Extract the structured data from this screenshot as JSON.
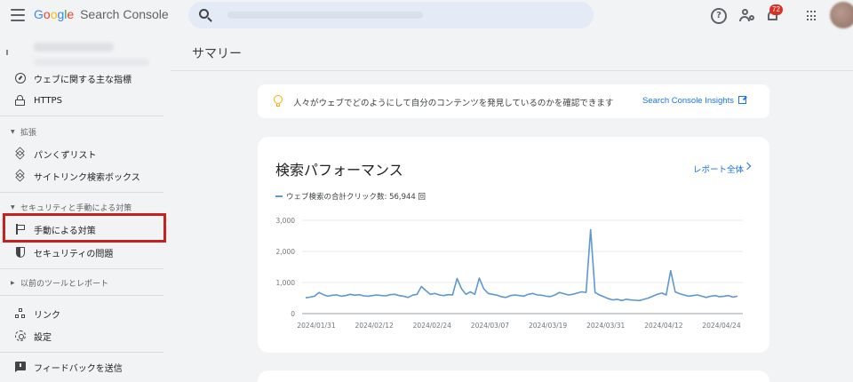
{
  "app": {
    "logo_letters": [
      "G",
      "o",
      "o",
      "g",
      "l",
      "e"
    ],
    "product_name": "Search Console"
  },
  "search": {
    "placeholder": "",
    "value": ""
  },
  "header": {
    "notifications_badge": "72",
    "help_icon": "help-circle-icon",
    "admin_icon": "manage-accounts-icon",
    "apps_icon": "apps-grid-icon"
  },
  "sidebar": {
    "items": [
      {
        "label": "ウェブに関する主な指標",
        "icon": "gauge-icon"
      },
      {
        "label": "HTTPS",
        "icon": "lock-icon"
      },
      {
        "label": "パンくずリスト",
        "icon": "layers-icon"
      },
      {
        "label": "サイトリンク検索ボックス",
        "icon": "layers-icon"
      },
      {
        "label": "手動による対策",
        "icon": "flag-icon"
      },
      {
        "label": "セキュリティの問題",
        "icon": "shield-icon"
      },
      {
        "label": "リンク",
        "icon": "link-icon"
      },
      {
        "label": "設定",
        "icon": "gear-icon"
      },
      {
        "label": "フィードバックを送信",
        "icon": "feedback-icon"
      }
    ],
    "sections": [
      {
        "label": "拡張"
      },
      {
        "label": "セキュリティと手動による対策"
      },
      {
        "label": "以前のツールとレポート"
      }
    ],
    "highlight_color": "#c5221f"
  },
  "main": {
    "page_title": "サマリー",
    "insights": {
      "text": "人々がウェブでどのようにして自分のコンテンツを発見しているのかを確認できます",
      "link": "Search Console Insights"
    },
    "performance": {
      "title": "検索パフォーマンス",
      "report_link": "レポート全体",
      "legend": "ウェブ検索の合計クリック数: 56,944 回",
      "line_color": "#5f97d3"
    }
  },
  "chart_data": {
    "type": "line",
    "title": "",
    "xlabel": "",
    "ylabel": "",
    "ylim": [
      0,
      3000
    ],
    "y_ticks": [
      "0",
      "1,000",
      "2,000",
      "3,000"
    ],
    "x_tick_labels": [
      "2024/01/31",
      "2024/02/12",
      "2024/02/24",
      "2024/03/07",
      "2024/03/19",
      "2024/03/31",
      "2024/04/12",
      "2024/04/24"
    ],
    "grid": true,
    "series": [
      {
        "name": "ウェブ検索の合計クリック数: 56,944 回",
        "values": [
          510,
          530,
          560,
          680,
          610,
          560,
          590,
          600,
          560,
          580,
          620,
          590,
          610,
          570,
          560,
          580,
          600,
          580,
          570,
          610,
          620,
          580,
          560,
          520,
          590,
          620,
          870,
          740,
          620,
          650,
          600,
          580,
          610,
          600,
          1130,
          800,
          620,
          700,
          620,
          1140,
          800,
          650,
          620,
          590,
          540,
          520,
          580,
          600,
          580,
          560,
          620,
          650,
          600,
          590,
          560,
          550,
          600,
          680,
          640,
          600,
          620,
          660,
          700,
          680,
          2700,
          680,
          600,
          540,
          480,
          440,
          460,
          420,
          460,
          440,
          430,
          420,
          460,
          500,
          560,
          620,
          660,
          600,
          1380,
          700,
          640,
          600,
          560,
          580,
          600,
          560,
          520,
          560,
          580,
          540,
          560,
          580,
          530,
          560
        ]
      }
    ]
  }
}
